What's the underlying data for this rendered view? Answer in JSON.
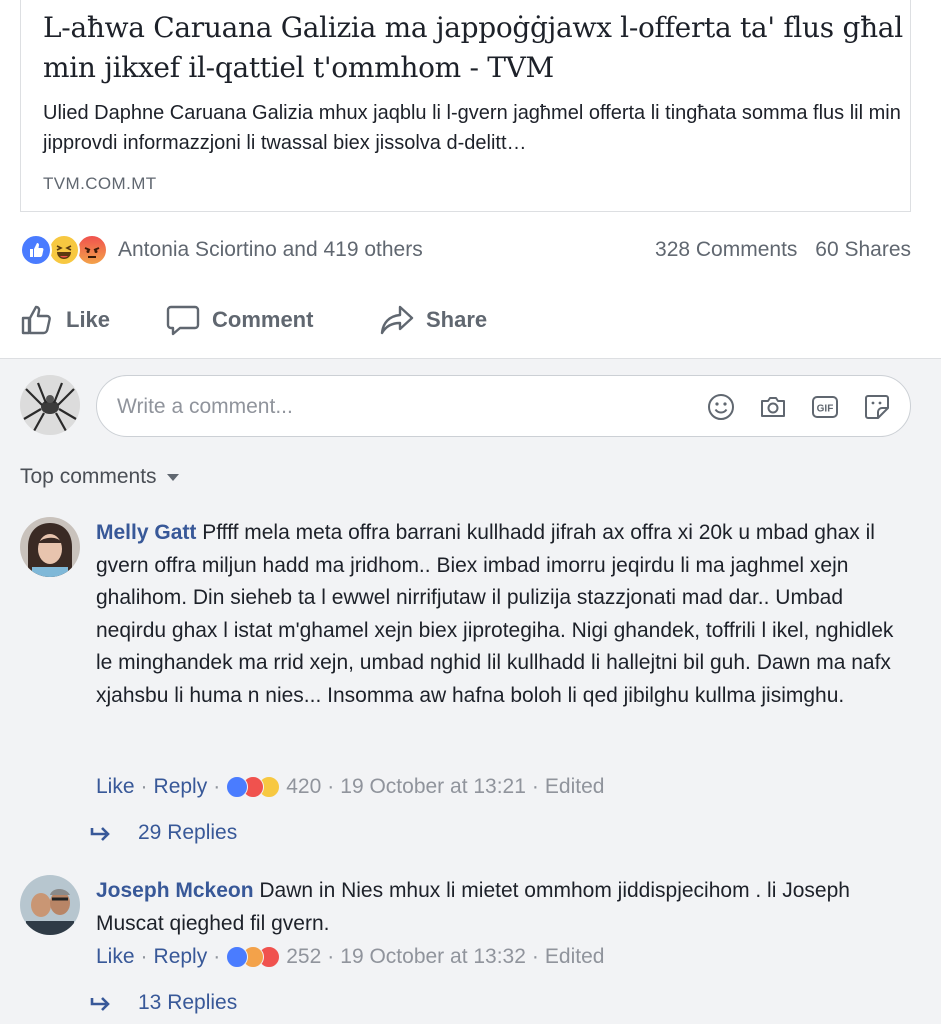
{
  "link": {
    "title": "L-aħwa Caruana Galizia ma jappoġġjawx l-offerta ta' flus għal min jikxef il-qattiel t'ommhom - TVM",
    "description": "Ulied Daphne Caruana Galizia mhux jaqblu li l-gvern jagħmel offerta li tingħata somma flus lil min jipprovdi informazzjoni li twassal biex jissolva d-delitt…",
    "domain": "TVM.COM.MT"
  },
  "stats": {
    "reactions_text": "Antonia Sciortino and 419 others",
    "comments": "328 Comments",
    "shares": "60 Shares",
    "reaction_icons": [
      "like-reaction-icon",
      "haha-reaction-icon",
      "angry-reaction-icon"
    ]
  },
  "actions": {
    "like": "Like",
    "comment": "Comment",
    "share": "Share"
  },
  "composer": {
    "placeholder": "Write a comment...",
    "icons": [
      "emoji-icon",
      "camera-icon",
      "gif-icon",
      "sticker-icon"
    ]
  },
  "filter": {
    "label": "Top comments"
  },
  "comments": [
    {
      "author": "Melly Gatt",
      "text": "Pffff mela meta offra barrani kullhadd jifrah ax offra xi 20k u mbad ghax il gvern offra miljun hadd ma jridhom.. Biex imbad imorru jeqirdu li ma jaghmel xejn ghalihom. Din sieheb ta l ewwel nirrifjutaw il pulizija stazzjonati mad dar.. Umbad neqirdu ghax l istat m'ghamel xejn biex jiprotegiha. Nigi ghandek, toffrili l ikel, nghidlek le minghandek ma rrid xejn, umbad nghid lil kullhadd li hallejtni bil guh. Dawn ma nafx xjahsbu li huma n nies... Insomma aw hafna boloh li qed jibilghu kullma jisimghu.",
      "like": "Like",
      "reply": "Reply",
      "reaction_count": "420",
      "timestamp": "19 October at 13:21",
      "edited": "Edited",
      "replies": "29 Replies"
    },
    {
      "author": "Joseph Mckeon",
      "text": "Dawn in Nies mhux li mietet ommhom jiddispjecihom . li Joseph Muscat qieghed fil gvern.",
      "like": "Like",
      "reply": "Reply",
      "reaction_count": "252",
      "timestamp": "19 October at 13:32",
      "edited": "Edited",
      "replies": "13 Replies"
    }
  ],
  "colors": {
    "link_blue": "#385898",
    "muted": "#90949c",
    "comment_bg": "#f2f3f5",
    "like_blue": "#4a7cff"
  }
}
